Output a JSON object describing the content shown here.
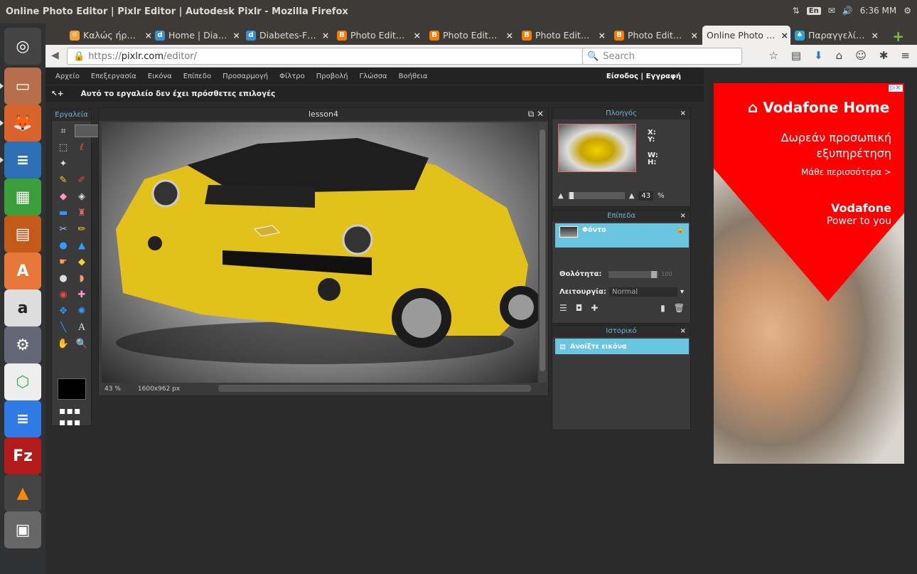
{
  "window": {
    "title": "Online Photo Editor | Pixlr Editor | Autodesk Pixlr - Mozilla Firefox"
  },
  "tray": {
    "lang": "En",
    "time": "6:36 ΜΜ"
  },
  "tabs": [
    {
      "label": "Καλώς ήρ…",
      "icon": "sun-favicon",
      "color": "#f2a23a"
    },
    {
      "label": "Home | Dia…",
      "icon": "d-favicon",
      "color": "#3b8fd3"
    },
    {
      "label": "Diabetes-F…",
      "icon": "d-favicon",
      "color": "#3b8fd3"
    },
    {
      "label": "Photo Edit…",
      "icon": "blogger-favicon",
      "color": "#f57d00"
    },
    {
      "label": "Photo Edit…",
      "icon": "blogger-favicon",
      "color": "#f57d00"
    },
    {
      "label": "Photo Edit…",
      "icon": "blogger-favicon",
      "color": "#f57d00"
    },
    {
      "label": "Photo Edit…",
      "icon": "blogger-favicon",
      "color": "#f57d00"
    },
    {
      "label": "Online Photo …",
      "icon": "none",
      "color": "#f0efee"
    },
    {
      "label": "Παραγγελί…",
      "icon": "bird-favicon",
      "color": "#2aa3d8"
    }
  ],
  "nav": {
    "url_host": "https://",
    "url_domain": "pixlr.com",
    "url_path": "/editor/",
    "search_placeholder": "Search"
  },
  "menu": [
    "Αρχείο",
    "Επεξεργασία",
    "Εικόνα",
    "Επίπεδο",
    "Προσαρμογή",
    "Φίλτρο",
    "Προβολή",
    "Γλώσσα",
    "Βοήθεια"
  ],
  "auth": {
    "login": "Είσοδος",
    "sep": "|",
    "register": "Εγγραφή"
  },
  "options_bar": "Αυτό το εργαλείο δεν έχει πρόσθετες επιλογές",
  "tools_title": "Εργαλεία",
  "canvas": {
    "title": "lesson4",
    "zoom": "43",
    "zoom_unit": "%",
    "size": "1600x962 px"
  },
  "navigator": {
    "title": "Πλοηγός",
    "x": "X:",
    "y": "Y:",
    "w": "W:",
    "h": "H:",
    "zoom": "43",
    "unit": "%"
  },
  "layers": {
    "title": "Επίπεδα",
    "layer_name": "Φόντο",
    "opacity_label": "Θολότητα:",
    "opacity_value": "100",
    "mode_label": "Λειτουργία:",
    "mode_value": "Normal"
  },
  "history": {
    "title": "Ιστορικό",
    "item": "Ανοίξτε εικόνα"
  },
  "ad": {
    "brand": "Vodafone Home",
    "line1": "Δωρεάν προσωπική",
    "line2": "εξυπηρέτηση",
    "more": "Μάθε περισσότερα >",
    "v1": "Vodafone",
    "v2": "Power to you"
  }
}
